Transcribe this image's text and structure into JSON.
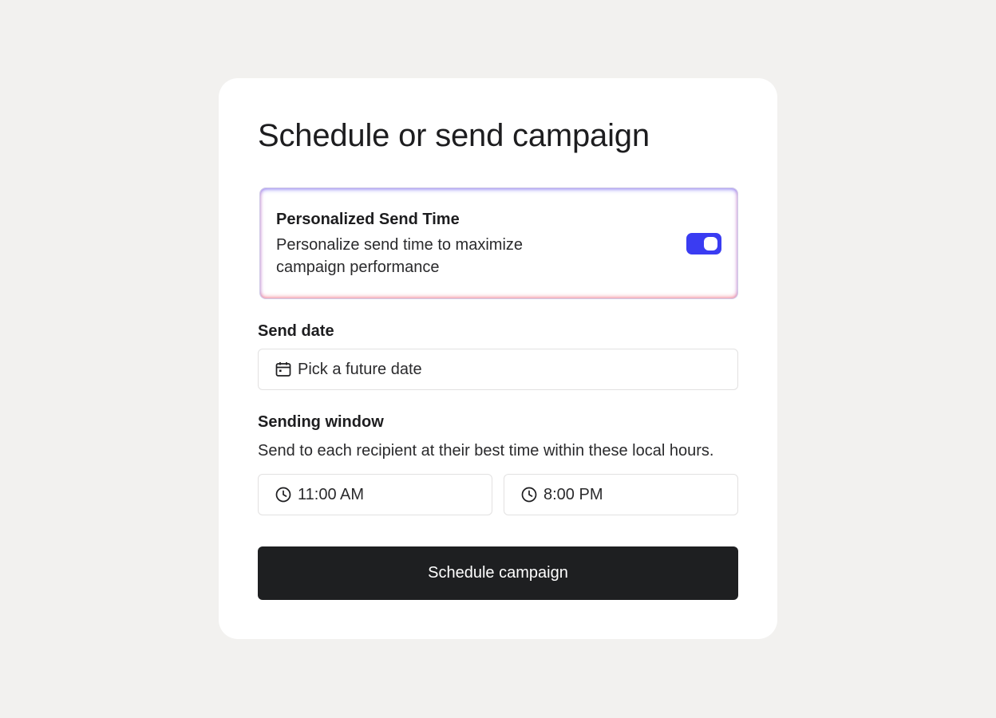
{
  "dialog": {
    "title": "Schedule or send campaign"
  },
  "personalized_send_time": {
    "title": "Personalized Send Time",
    "description": "Personalize send time to maximize campaign performance",
    "enabled": true,
    "toggle_color": "#3a3cf2"
  },
  "send_date": {
    "label": "Send date",
    "placeholder": "Pick a future date",
    "icon": "calendar-icon"
  },
  "sending_window": {
    "label": "Sending window",
    "helper": "Send to each recipient at their best time within these local hours.",
    "start_time": "11:00 AM",
    "end_time": "8:00 PM",
    "icon": "clock-icon"
  },
  "actions": {
    "submit_label": "Schedule campaign",
    "submit_color": "#1e1f21"
  }
}
